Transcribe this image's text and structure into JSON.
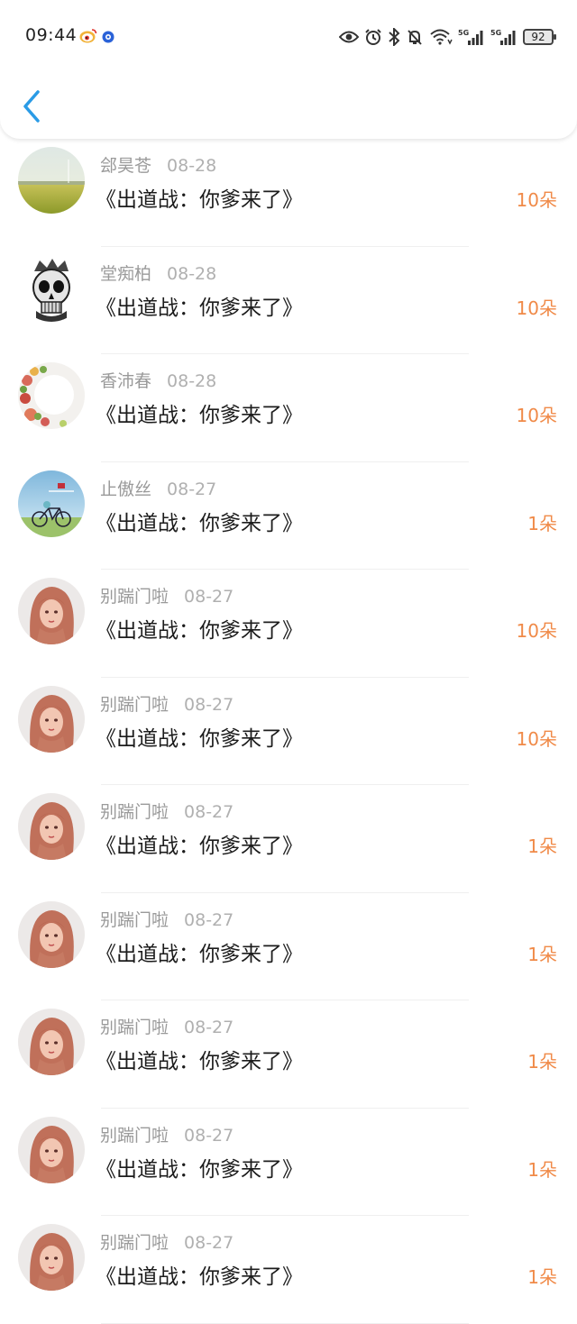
{
  "status_bar": {
    "time": "09:44",
    "icons": [
      "weibo-icon",
      "dot-icon",
      "eye-icon",
      "alarm-icon",
      "bluetooth-icon",
      "mute-icon",
      "wifi-icon",
      "signal-5g-icon",
      "signal-5g-icon"
    ],
    "battery": "92"
  },
  "header": {
    "back_icon": "chevron-left-icon",
    "accent_color": "#2a9be6"
  },
  "records": [
    {
      "name": "郐昊苍",
      "date": "08-28",
      "title": "《出道战：你爹来了》",
      "count": "10朵",
      "avatar": "landscape"
    },
    {
      "name": "堂痴柏",
      "date": "08-28",
      "title": "《出道战：你爹来了》",
      "count": "10朵",
      "avatar": "skull"
    },
    {
      "name": "香沛春",
      "date": "08-28",
      "title": "《出道战：你爹来了》",
      "count": "10朵",
      "avatar": "floral"
    },
    {
      "name": "止傲丝",
      "date": "08-27",
      "title": "《出道战：你爹来了》",
      "count": "1朵",
      "avatar": "bicycle"
    },
    {
      "name": "别踹门啦",
      "date": "08-27",
      "title": "《出道战：你爹来了》",
      "count": "10朵",
      "avatar": "girl"
    },
    {
      "name": "别踹门啦",
      "date": "08-27",
      "title": "《出道战：你爹来了》",
      "count": "10朵",
      "avatar": "girl"
    },
    {
      "name": "别踹门啦",
      "date": "08-27",
      "title": "《出道战：你爹来了》",
      "count": "1朵",
      "avatar": "girl"
    },
    {
      "name": "别踹门啦",
      "date": "08-27",
      "title": "《出道战：你爹来了》",
      "count": "1朵",
      "avatar": "girl"
    },
    {
      "name": "别踹门啦",
      "date": "08-27",
      "title": "《出道战：你爹来了》",
      "count": "1朵",
      "avatar": "girl"
    },
    {
      "name": "别踹门啦",
      "date": "08-27",
      "title": "《出道战：你爹来了》",
      "count": "1朵",
      "avatar": "girl"
    },
    {
      "name": "别踹门啦",
      "date": "08-27",
      "title": "《出道战：你爹来了》",
      "count": "1朵",
      "avatar": "girl"
    }
  ],
  "colors": {
    "count": "#f08a48",
    "name": "#9a9a9a",
    "title": "#1c1c1c"
  }
}
